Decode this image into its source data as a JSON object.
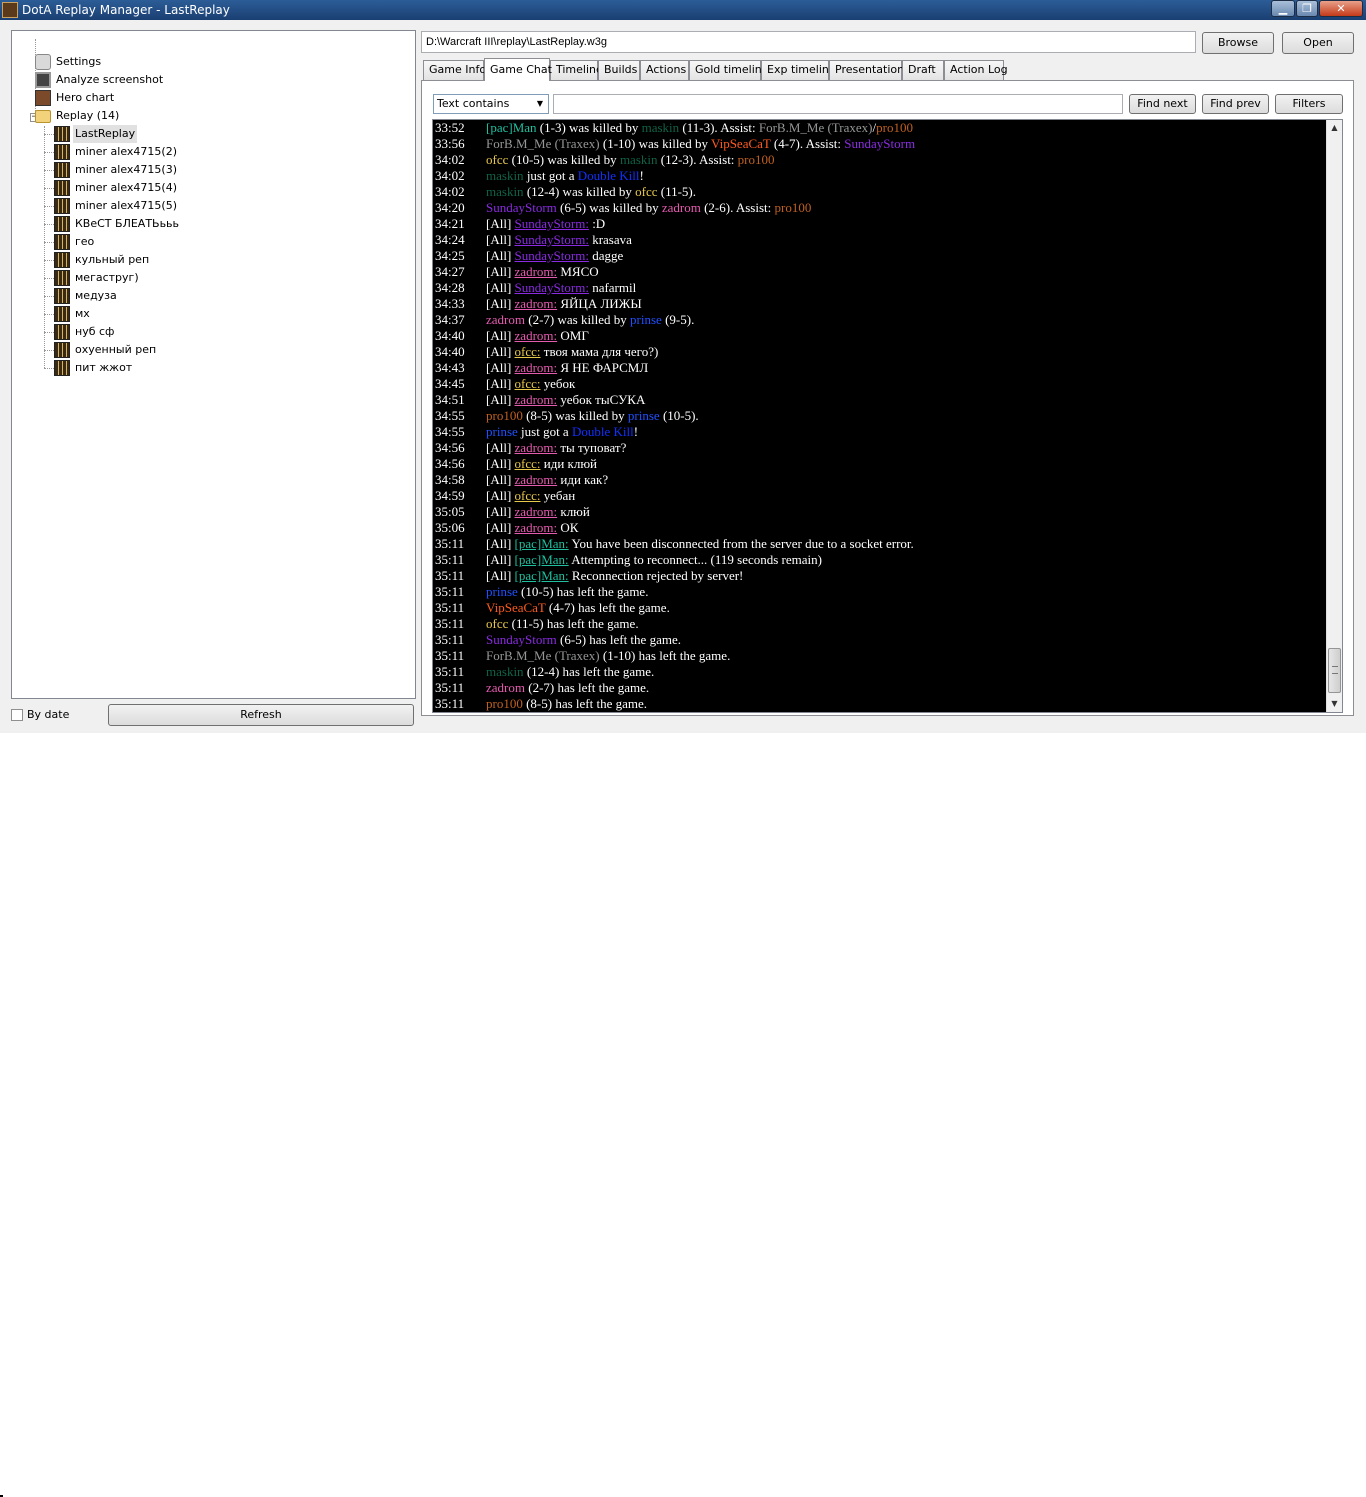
{
  "window": {
    "title": "DotA Replay Manager - LastReplay",
    "minimize_glyph": "▁",
    "maximize_glyph": "❐",
    "close_glyph": "✕"
  },
  "tree": {
    "items": [
      {
        "label": "Settings",
        "icon": "settings-icon"
      },
      {
        "label": "Analyze screenshot",
        "icon": "monitor-icon"
      },
      {
        "label": "Hero chart",
        "icon": "hero-chart-icon"
      },
      {
        "label": "Replay (14)",
        "icon": "folder-icon",
        "expanded": true,
        "expander_glyph": "−"
      }
    ],
    "replays": [
      "LastReplay",
      "miner alex4715(2)",
      "miner alex4715(3)",
      "miner alex4715(4)",
      "miner alex4715(5)",
      "КВеСТ БЛЕАТЬььь",
      "гео",
      "кульный реп",
      "мегаструг)",
      "медуза",
      "мх",
      "нуб сф",
      "охуенный реп",
      "пит жжот"
    ],
    "selected": "LastReplay"
  },
  "bottom_left": {
    "by_date_label": "By date",
    "by_date_checked": false,
    "refresh_label": "Refresh"
  },
  "path": {
    "value": "D:\\Warcraft III\\replay\\LastReplay.w3g",
    "browse_label": "Browse",
    "open_label": "Open"
  },
  "tabs": [
    "Game Info",
    "Game Chat",
    "Timeline",
    "Builds",
    "Actions",
    "Gold timeline",
    "Exp timeline",
    "Presentation",
    "Draft",
    "Action Log"
  ],
  "active_tab": "Game Chat",
  "search": {
    "mode": "Text contains",
    "arrow_glyph": "▼",
    "query": "",
    "find_next_label": "Find next",
    "find_prev_label": "Find prev",
    "filters_label": "Filters"
  },
  "scrollbar": {
    "up_glyph": "▲",
    "down_glyph": "▼",
    "position_fraction": 1.0
  },
  "colors": {
    "pacman": "#1fbf9f",
    "forb": "#959697",
    "maskin": "#106246",
    "ofcc": "#e6c84a",
    "pro100": "#c06020",
    "vipseacat": "#ff5a1e",
    "sundaystorm": "#8a2be2",
    "zadrom": "#e55bb0",
    "prinse": "#2050ff",
    "doublekill": "#1030ff",
    "text": "#ffffff",
    "chat_bg": "#000000"
  },
  "chat": [
    {
      "time": "33:52",
      "parts": [
        {
          "t": "[pac]Man",
          "c": "pacman"
        },
        {
          "t": " (1-3) was killed by "
        },
        {
          "t": "maskin",
          "c": "maskin"
        },
        {
          "t": " (11-3). Assist: "
        },
        {
          "t": "ForB.M_Me (Traxex)",
          "c": "forb"
        },
        {
          "t": "/"
        },
        {
          "t": "pro100",
          "c": "pro100"
        }
      ]
    },
    {
      "time": "33:56",
      "parts": [
        {
          "t": "ForB.M_Me (Traxex)",
          "c": "forb"
        },
        {
          "t": " (1-10) was killed by "
        },
        {
          "t": "VipSeaCaT",
          "c": "vipseacat"
        },
        {
          "t": " (4-7). Assist: "
        },
        {
          "t": "SundayStorm",
          "c": "sundaystorm"
        }
      ]
    },
    {
      "time": "34:02",
      "parts": [
        {
          "t": "ofcc",
          "c": "ofcc"
        },
        {
          "t": " (10-5) was killed by "
        },
        {
          "t": "maskin",
          "c": "maskin"
        },
        {
          "t": " (12-3). Assist: "
        },
        {
          "t": "pro100",
          "c": "pro100"
        }
      ]
    },
    {
      "time": "34:02",
      "parts": [
        {
          "t": "maskin",
          "c": "maskin"
        },
        {
          "t": " just got a "
        },
        {
          "t": "Double Kill",
          "c": "doublekill"
        },
        {
          "t": "!"
        }
      ]
    },
    {
      "time": "34:02",
      "parts": [
        {
          "t": "maskin",
          "c": "maskin"
        },
        {
          "t": " (12-4) was killed by "
        },
        {
          "t": "ofcc",
          "c": "ofcc"
        },
        {
          "t": " (11-5)."
        }
      ]
    },
    {
      "time": "34:20",
      "parts": [
        {
          "t": "SundayStorm",
          "c": "sundaystorm"
        },
        {
          "t": " (6-5) was killed by "
        },
        {
          "t": "zadrom",
          "c": "zadrom"
        },
        {
          "t": " (2-6). Assist: "
        },
        {
          "t": "pro100",
          "c": "pro100"
        }
      ]
    },
    {
      "time": "34:21",
      "parts": [
        {
          "t": "[All] "
        },
        {
          "t": "SundayStorm:",
          "c": "sundaystorm",
          "u": true
        },
        {
          "t": " :D"
        }
      ]
    },
    {
      "time": "34:24",
      "parts": [
        {
          "t": "[All] "
        },
        {
          "t": "SundayStorm:",
          "c": "sundaystorm",
          "u": true
        },
        {
          "t": " krasava"
        }
      ]
    },
    {
      "time": "34:25",
      "parts": [
        {
          "t": "[All] "
        },
        {
          "t": "SundayStorm:",
          "c": "sundaystorm",
          "u": true
        },
        {
          "t": " dagge"
        }
      ]
    },
    {
      "time": "34:27",
      "parts": [
        {
          "t": "[All] "
        },
        {
          "t": "zadrom:",
          "c": "zadrom",
          "u": true
        },
        {
          "t": " МЯСО"
        }
      ]
    },
    {
      "time": "34:28",
      "parts": [
        {
          "t": "[All] "
        },
        {
          "t": "SundayStorm:",
          "c": "sundaystorm",
          "u": true
        },
        {
          "t": " nafarmil"
        }
      ]
    },
    {
      "time": "34:33",
      "parts": [
        {
          "t": "[All] "
        },
        {
          "t": "zadrom:",
          "c": "zadrom",
          "u": true
        },
        {
          "t": " ЯЙЦА ЛИЖЫ"
        }
      ]
    },
    {
      "time": "34:37",
      "parts": [
        {
          "t": "zadrom",
          "c": "zadrom"
        },
        {
          "t": " (2-7) was killed by "
        },
        {
          "t": "prinse",
          "c": "prinse"
        },
        {
          "t": " (9-5)."
        }
      ]
    },
    {
      "time": "34:40",
      "parts": [
        {
          "t": "[All] "
        },
        {
          "t": "zadrom:",
          "c": "zadrom",
          "u": true
        },
        {
          "t": " ОМГ"
        }
      ]
    },
    {
      "time": "34:40",
      "parts": [
        {
          "t": "[All] "
        },
        {
          "t": "ofcc:",
          "c": "ofcc",
          "u": true
        },
        {
          "t": " твоя мама для чего?)"
        }
      ]
    },
    {
      "time": "34:43",
      "parts": [
        {
          "t": "[All] "
        },
        {
          "t": "zadrom:",
          "c": "zadrom",
          "u": true
        },
        {
          "t": " Я НЕ ФАРСМЛ"
        }
      ]
    },
    {
      "time": "34:45",
      "parts": [
        {
          "t": "[All] "
        },
        {
          "t": "ofcc:",
          "c": "ofcc",
          "u": true
        },
        {
          "t": " уебок"
        }
      ]
    },
    {
      "time": "34:51",
      "parts": [
        {
          "t": "[All] "
        },
        {
          "t": "zadrom:",
          "c": "zadrom",
          "u": true
        },
        {
          "t": " уебок тыСУКА"
        }
      ]
    },
    {
      "time": "34:55",
      "parts": [
        {
          "t": "pro100",
          "c": "pro100"
        },
        {
          "t": " (8-5) was killed by "
        },
        {
          "t": "prinse",
          "c": "prinse"
        },
        {
          "t": " (10-5)."
        }
      ]
    },
    {
      "time": "34:55",
      "parts": [
        {
          "t": "prinse",
          "c": "prinse"
        },
        {
          "t": " just got a "
        },
        {
          "t": "Double Kill",
          "c": "doublekill"
        },
        {
          "t": "!"
        }
      ]
    },
    {
      "time": "34:56",
      "parts": [
        {
          "t": "[All] "
        },
        {
          "t": "zadrom:",
          "c": "zadrom",
          "u": true
        },
        {
          "t": " ты туповат?"
        }
      ]
    },
    {
      "time": "34:56",
      "parts": [
        {
          "t": "[All] "
        },
        {
          "t": "ofcc:",
          "c": "ofcc",
          "u": true
        },
        {
          "t": " иди клюй"
        }
      ]
    },
    {
      "time": "34:58",
      "parts": [
        {
          "t": "[All] "
        },
        {
          "t": "zadrom:",
          "c": "zadrom",
          "u": true
        },
        {
          "t": " иди как?"
        }
      ]
    },
    {
      "time": "34:59",
      "parts": [
        {
          "t": "[All] "
        },
        {
          "t": "ofcc:",
          "c": "ofcc",
          "u": true
        },
        {
          "t": " уебан"
        }
      ]
    },
    {
      "time": "35:05",
      "parts": [
        {
          "t": "[All] "
        },
        {
          "t": "zadrom:",
          "c": "zadrom",
          "u": true
        },
        {
          "t": " клюй"
        }
      ]
    },
    {
      "time": "35:06",
      "parts": [
        {
          "t": "[All] "
        },
        {
          "t": "zadrom:",
          "c": "zadrom",
          "u": true
        },
        {
          "t": " ОК"
        }
      ]
    },
    {
      "time": "35:11",
      "parts": [
        {
          "t": "[All] "
        },
        {
          "t": "[pac]Man:",
          "c": "pacman",
          "u": true
        },
        {
          "t": " You have been disconnected from the server due to a socket error."
        }
      ]
    },
    {
      "time": "35:11",
      "parts": [
        {
          "t": "[All] "
        },
        {
          "t": "[pac]Man:",
          "c": "pacman",
          "u": true
        },
        {
          "t": " Attempting to reconnect... (119 seconds remain)"
        }
      ]
    },
    {
      "time": "35:11",
      "parts": [
        {
          "t": "[All] "
        },
        {
          "t": "[pac]Man:",
          "c": "pacman",
          "u": true
        },
        {
          "t": " Reconnection rejected by server!"
        }
      ]
    },
    {
      "time": "35:11",
      "parts": [
        {
          "t": "prinse",
          "c": "prinse"
        },
        {
          "t": " (10-5) has left the game."
        }
      ]
    },
    {
      "time": "35:11",
      "parts": [
        {
          "t": "VipSeaCaT",
          "c": "vipseacat"
        },
        {
          "t": " (4-7) has left the game."
        }
      ]
    },
    {
      "time": "35:11",
      "parts": [
        {
          "t": "ofcc",
          "c": "ofcc"
        },
        {
          "t": " (11-5) has left the game."
        }
      ]
    },
    {
      "time": "35:11",
      "parts": [
        {
          "t": "SundayStorm",
          "c": "sundaystorm"
        },
        {
          "t": " (6-5) has left the game."
        }
      ]
    },
    {
      "time": "35:11",
      "parts": [
        {
          "t": "ForB.M_Me (Traxex)",
          "c": "forb"
        },
        {
          "t": " (1-10) has left the game."
        }
      ]
    },
    {
      "time": "35:11",
      "parts": [
        {
          "t": "maskin",
          "c": "maskin"
        },
        {
          "t": " (12-4) has left the game."
        }
      ]
    },
    {
      "time": "35:11",
      "parts": [
        {
          "t": "zadrom",
          "c": "zadrom"
        },
        {
          "t": " (2-7) has left the game."
        }
      ]
    },
    {
      "time": "35:11",
      "parts": [
        {
          "t": "pro100",
          "c": "pro100"
        },
        {
          "t": " (8-5) has left the game."
        }
      ]
    }
  ]
}
